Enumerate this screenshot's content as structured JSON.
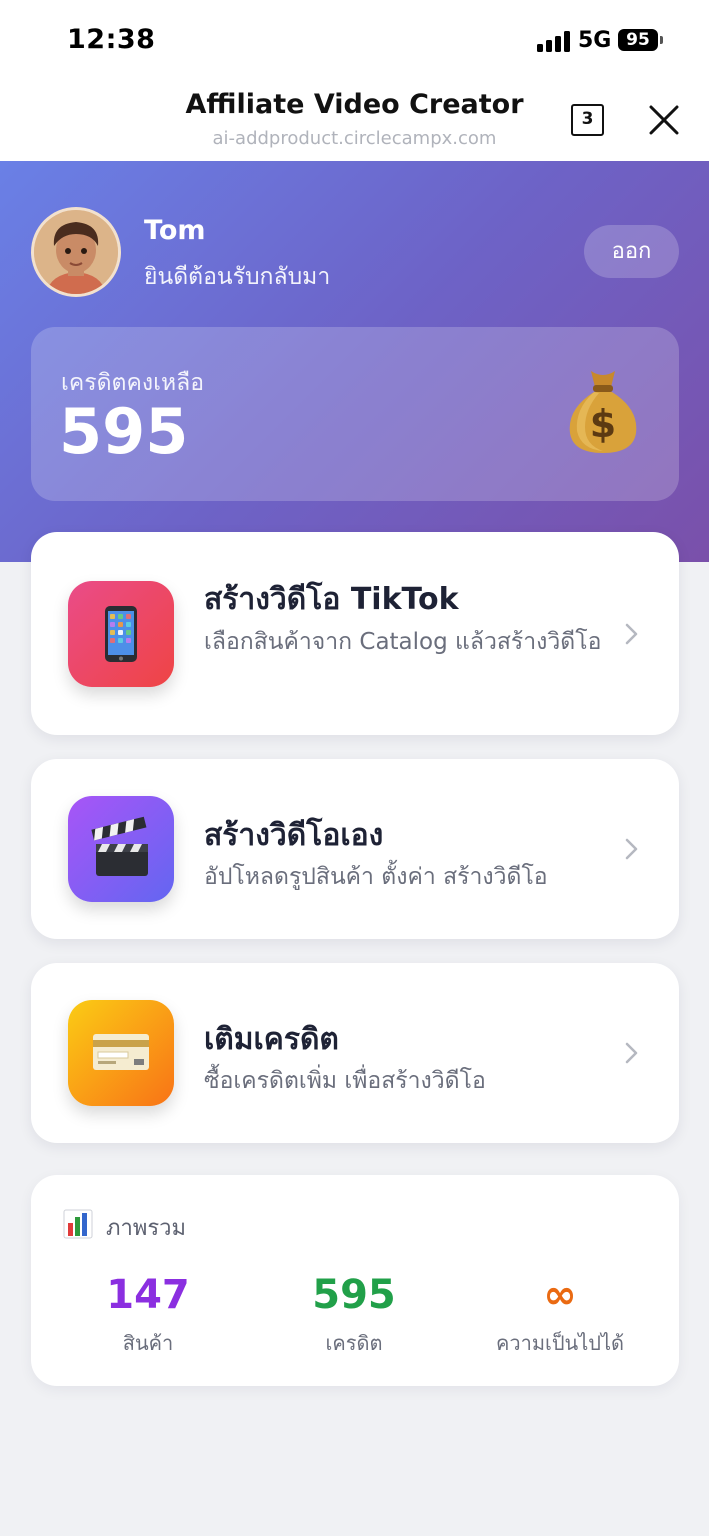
{
  "status_bar": {
    "time": "12:38",
    "network": "5G",
    "battery": "95"
  },
  "browser": {
    "title": "Affiliate Video Creator",
    "url": "ai-addproduct.circlecampx.com",
    "tab_count": "3"
  },
  "header": {
    "user_name": "Tom",
    "welcome": "ยินดีต้อนรับกลับมา",
    "logout_label": "ออก",
    "credit_label": "เครดิตคงเหลือ",
    "credit_value": "595"
  },
  "actions": [
    {
      "title": "สร้างวิดีโอ TikTok",
      "description": "เลือกสินค้าจาก Catalog แล้วสร้างวิดีโอ",
      "icon": "mobile-phone-icon",
      "color_from": "#ea4c89",
      "color_to": "#ef4444"
    },
    {
      "title": "สร้างวิดีโอเอง",
      "description": "อัปโหลดรูปสินค้า ตั้งค่า สร้างวิดีโอ",
      "icon": "clapper-board-icon",
      "color_from": "#a855f7",
      "color_to": "#6366f1"
    },
    {
      "title": "เติมเครดิต",
      "description": "ซื้อเครดิตเพิ่ม เพื่อสร้างวิดีโอ",
      "icon": "credit-card-icon",
      "color_from": "#facc15",
      "color_to": "#f97316"
    }
  ],
  "overview": {
    "title": "ภาพรวม",
    "stats": [
      {
        "value": "147",
        "label": "สินค้า",
        "color": "#8b2fe0"
      },
      {
        "value": "595",
        "label": "เครดิต",
        "color": "#21a049"
      },
      {
        "value": "∞",
        "label": "ความเป็นไปได้",
        "color": "#ea6a12"
      }
    ]
  }
}
